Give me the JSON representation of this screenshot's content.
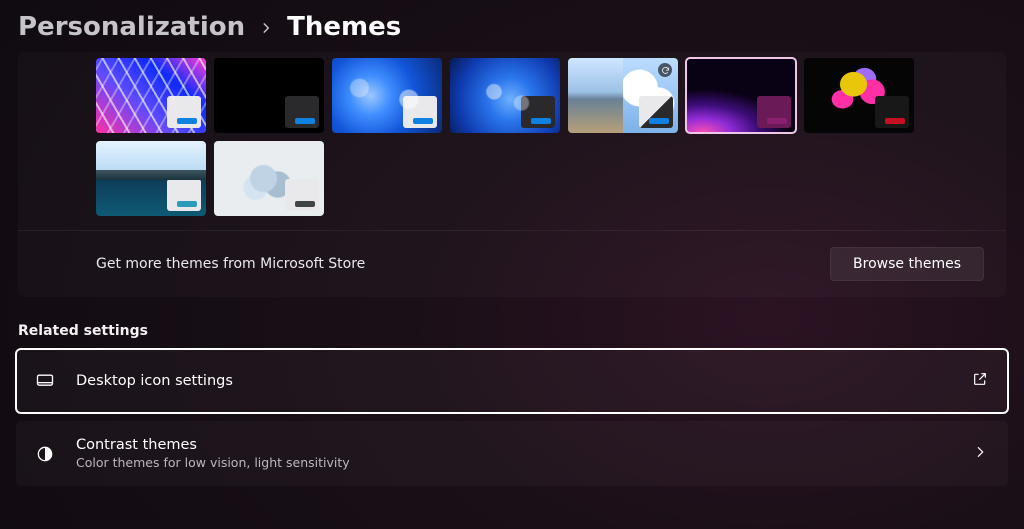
{
  "breadcrumb": {
    "parent": "Personalization",
    "current": "Themes"
  },
  "themes": [
    {
      "name": "neon-lines",
      "chip": "light",
      "accent": "#1081e0",
      "selected": false,
      "badge": false
    },
    {
      "name": "pure-black",
      "chip": "dark",
      "accent": "#1081e0",
      "selected": false,
      "badge": false
    },
    {
      "name": "bloom-light",
      "chip": "light",
      "accent": "#1081e0",
      "selected": false,
      "badge": false
    },
    {
      "name": "bloom-dark",
      "chip": "dark",
      "accent": "#1081e0",
      "selected": false,
      "badge": false
    },
    {
      "name": "landscapes",
      "chip": "mix",
      "accent": "#1081e0",
      "selected": false,
      "badge": true
    },
    {
      "name": "purple-glow",
      "chip": "purple",
      "accent": "#8a1f6f",
      "selected": true,
      "badge": false
    },
    {
      "name": "petals-dark",
      "chip": "blackish",
      "accent": "#c41022",
      "selected": false,
      "badge": false
    },
    {
      "name": "lake-calm",
      "chip": "light",
      "accent": "#2a9bb8",
      "selected": false,
      "badge": false
    },
    {
      "name": "swirl-light",
      "chip": "light",
      "accent": "#3f4547",
      "selected": false,
      "badge": false
    }
  ],
  "store": {
    "text": "Get more themes from Microsoft Store",
    "button": "Browse themes"
  },
  "related": {
    "heading": "Related settings",
    "items": [
      {
        "icon": "monitor",
        "title": "Desktop icon settings",
        "sub": "",
        "trail": "external",
        "highlight": true
      },
      {
        "icon": "contrast",
        "title": "Contrast themes",
        "sub": "Color themes for low vision, light sensitivity",
        "trail": "chevron",
        "highlight": false
      }
    ]
  }
}
